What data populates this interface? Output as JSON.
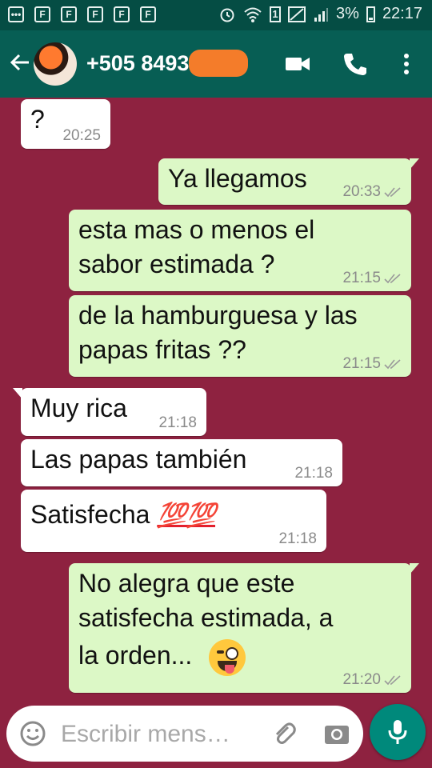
{
  "status_bar": {
    "notif_icons": [
      "F",
      "F",
      "F",
      "F",
      "F"
    ],
    "sim_label": "1",
    "battery": "3%",
    "time": "22:17"
  },
  "header": {
    "contact": "+505 8493",
    "icons": [
      "back-arrow-icon",
      "video-call-icon",
      "phone-icon",
      "more-options-icon"
    ]
  },
  "messages": [
    {
      "dir": "in",
      "lines": [
        "?"
      ],
      "time": "20:25"
    },
    {
      "dir": "out",
      "lines": [
        "Ya llegamos"
      ],
      "time": "20:33"
    },
    {
      "dir": "out",
      "lines": [
        "esta mas o menos el",
        "sabor estimada ?"
      ],
      "time": "21:15"
    },
    {
      "dir": "out",
      "lines": [
        "de la hamburguesa y las",
        "papas fritas ??"
      ],
      "time": "21:15"
    },
    {
      "dir": "in",
      "lines": [
        "Muy rica"
      ],
      "time": "21:18"
    },
    {
      "dir": "in",
      "lines": [
        "Las papas también"
      ],
      "time": "21:18"
    },
    {
      "dir": "in",
      "lines": [
        "Satisfecha"
      ],
      "emoji": "💯💯",
      "time": "21:18"
    },
    {
      "dir": "out",
      "lines": [
        "No alegra que este",
        "satisfecha estimada, a",
        "la orden..."
      ],
      "emoji": "wink-tongue-emoji",
      "time": "21:20"
    }
  ],
  "input": {
    "placeholder": "Escribir mens…",
    "icons": [
      "emoji-icon",
      "attach-icon",
      "camera-icon",
      "mic-icon"
    ]
  },
  "colors": {
    "status_bar": "#054d44",
    "app_bar": "#075e54",
    "wallpaper": "#8e2240",
    "bubble_out": "#dcf8c6",
    "bubble_in": "#ffffff",
    "fab": "#00897b"
  }
}
